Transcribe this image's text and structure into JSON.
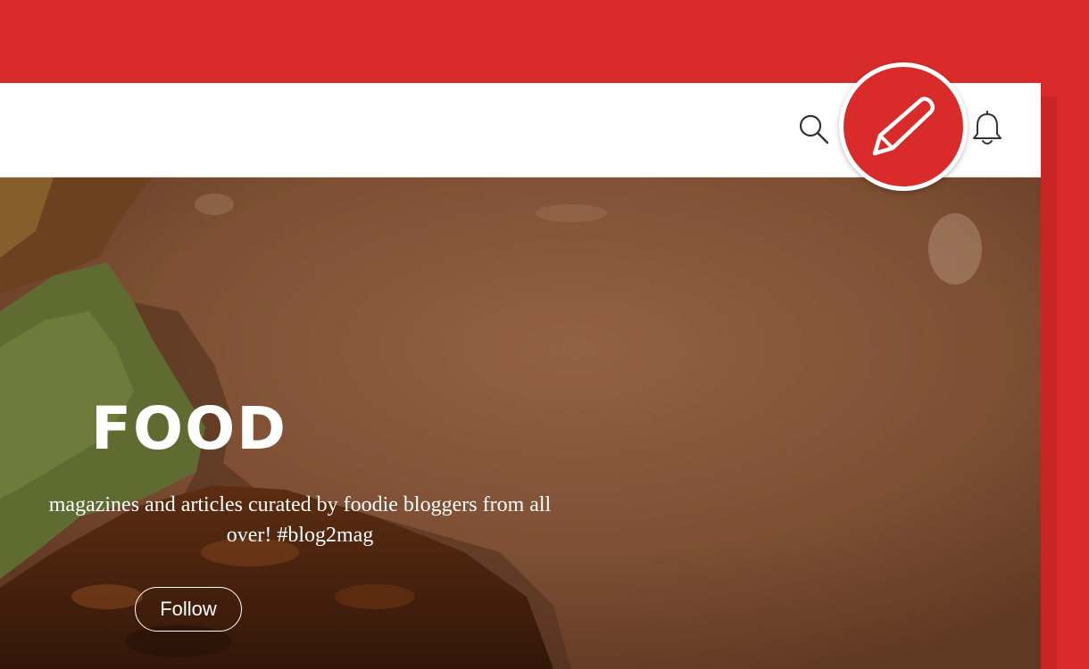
{
  "app": {
    "accent_color": "#d82b2a"
  },
  "topbar": {
    "search_icon": "search-icon",
    "bell_icon": "bell-icon"
  },
  "compose": {
    "icon": "pencil-icon"
  },
  "hero": {
    "title": "FOOD",
    "description_line1": "magazines and articles curated by foodie bloggers from all",
    "description_line2": "over! #blog2mag",
    "follow_label": "Follow",
    "background_image": "burger-photo"
  }
}
